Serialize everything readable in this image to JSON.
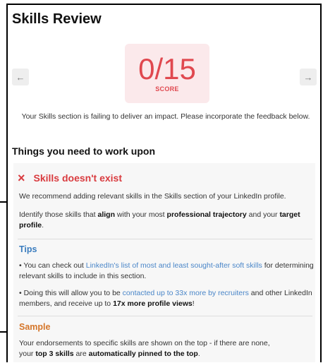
{
  "title": "Skills Review",
  "score": {
    "value": "0/15",
    "label": "SCORE",
    "prev_icon": "←",
    "next_icon": "→"
  },
  "score_message": "Your Skills section is failing to deliver an impact. Please incorporate the feedback below.",
  "section_heading": "Things you need to work upon",
  "issue": {
    "icon": "×",
    "title": "Skills doesn't exist",
    "p1": "We recommend adding relevant skills in the Skills section of your LinkedIn profile.",
    "p2_a": "Identify those skills that ",
    "p2_b": "align",
    "p2_c": " with your most ",
    "p2_d": "professional trajectory",
    "p2_e": " and your ",
    "p2_f": "target profile",
    "p2_g": "."
  },
  "tips": {
    "heading": "Tips",
    "t1_a": "• You can check out ",
    "t1_link": "LinkedIn's list of most and least sought-after soft skills",
    "t1_b": " for determining relevant skills to include in this section.",
    "t2_a": "• Doing this will allow you to be ",
    "t2_link": "contacted up to 33x more by recruiters",
    "t2_b": " and other LinkedIn members, and receive up to ",
    "t2_bold": "17x more profile views",
    "t2_c": "!"
  },
  "sample": {
    "heading": "Sample",
    "s1": "Your endorsements to specific skills are shown on the top - if there are none, ",
    "s2_a": "your ",
    "s2_b": "top 3 skills",
    "s2_c": " are ",
    "s2_d": "automatically pinned to the top",
    "s2_e": "."
  },
  "colors": {
    "score_red": "#e0484f",
    "score_bg": "#fbe9eb",
    "tips_blue": "#3b7dbf",
    "sample_orange": "#d5762a",
    "link_blue": "#4a86c8"
  }
}
